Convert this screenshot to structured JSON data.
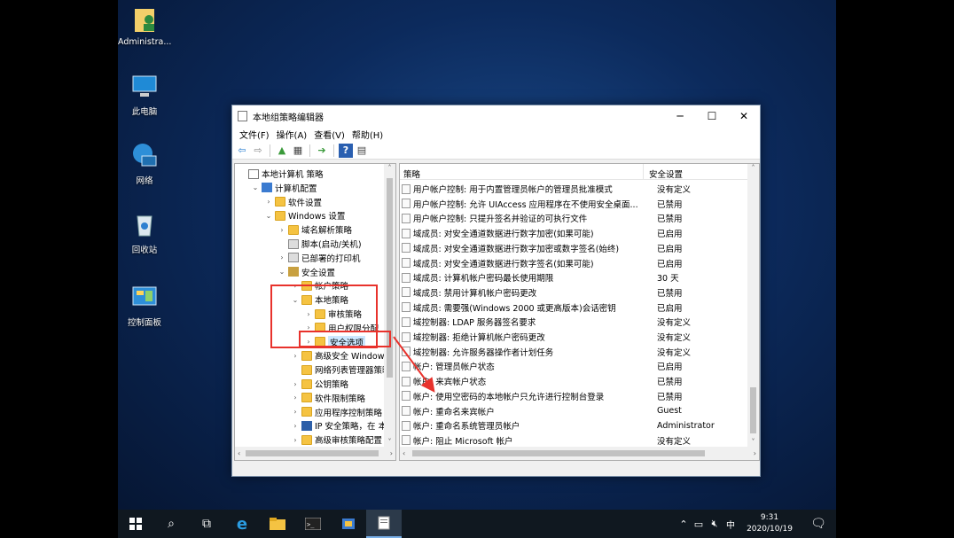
{
  "desktop_icons": [
    {
      "label": "Administra..."
    },
    {
      "label": "此电脑"
    },
    {
      "label": "网络"
    },
    {
      "label": "回收站"
    },
    {
      "label": "控制面板"
    }
  ],
  "window": {
    "title": "本地组策略编辑器"
  },
  "menu": [
    "文件(F)",
    "操作(A)",
    "查看(V)",
    "帮助(H)"
  ],
  "tree": [
    {
      "label": "本地计算机 策略",
      "level": 0,
      "exp": ""
    },
    {
      "label": "计算机配置",
      "level": 1,
      "exp": "⌄"
    },
    {
      "label": "软件设置",
      "level": 2,
      "exp": "›"
    },
    {
      "label": "Windows 设置",
      "level": 2,
      "exp": "⌄"
    },
    {
      "label": "域名解析策略",
      "level": 3,
      "exp": "›"
    },
    {
      "label": "脚本(启动/关机)",
      "level": 3,
      "exp": ""
    },
    {
      "label": "已部署的打印机",
      "level": 3,
      "exp": "›"
    },
    {
      "label": "安全设置",
      "level": 3,
      "exp": "⌄"
    },
    {
      "label": "帐户策略",
      "level": 4,
      "exp": "›"
    },
    {
      "label": "本地策略",
      "level": 4,
      "exp": "⌄"
    },
    {
      "label": "审核策略",
      "level": 5,
      "exp": "›"
    },
    {
      "label": "用户权限分配",
      "level": 5,
      "exp": "›"
    },
    {
      "label": "安全选项",
      "level": 5,
      "exp": "›"
    },
    {
      "label": "高级安全 Windows Defender",
      "level": 4,
      "exp": "›"
    },
    {
      "label": "网络列表管理器策略",
      "level": 4,
      "exp": ""
    },
    {
      "label": "公钥策略",
      "level": 4,
      "exp": "›"
    },
    {
      "label": "软件限制策略",
      "level": 4,
      "exp": "›"
    },
    {
      "label": "应用程序控制策略",
      "level": 4,
      "exp": "›"
    },
    {
      "label": "IP 安全策略，在 本地计算机",
      "level": 4,
      "exp": "›"
    },
    {
      "label": "高级审核策略配置",
      "level": 4,
      "exp": "›"
    }
  ],
  "list_header": {
    "policy": "策略",
    "setting": "安全设置"
  },
  "list": [
    {
      "policy": "用户帐户控制: 用于内置管理员帐户的管理员批准模式",
      "setting": "没有定义"
    },
    {
      "policy": "用户帐户控制: 允许 UIAccess 应用程序在不使用安全桌面...",
      "setting": "已禁用"
    },
    {
      "policy": "用户帐户控制: 只提升签名并验证的可执行文件",
      "setting": "已禁用"
    },
    {
      "policy": "域成员: 对安全通道数据进行数字加密(如果可能)",
      "setting": "已启用"
    },
    {
      "policy": "域成员: 对安全通道数据进行数字加密或数字签名(始终)",
      "setting": "已启用"
    },
    {
      "policy": "域成员: 对安全通道数据进行数字签名(如果可能)",
      "setting": "已启用"
    },
    {
      "policy": "域成员: 计算机帐户密码最长使用期限",
      "setting": "30 天"
    },
    {
      "policy": "域成员: 禁用计算机帐户密码更改",
      "setting": "已禁用"
    },
    {
      "policy": "域成员: 需要强(Windows 2000 或更高版本)会话密钥",
      "setting": "已启用"
    },
    {
      "policy": "域控制器: LDAP 服务器签名要求",
      "setting": "没有定义"
    },
    {
      "policy": "域控制器: 拒绝计算机帐户密码更改",
      "setting": "没有定义"
    },
    {
      "policy": "域控制器: 允许服务器操作者计划任务",
      "setting": "没有定义"
    },
    {
      "policy": "帐户: 管理员帐户状态",
      "setting": "已启用"
    },
    {
      "policy": "帐户: 来宾帐户状态",
      "setting": "已禁用"
    },
    {
      "policy": "帐户: 使用空密码的本地帐户只允许进行控制台登录",
      "setting": "已禁用"
    },
    {
      "policy": "帐户: 重命名来宾帐户",
      "setting": "Guest"
    },
    {
      "policy": "帐户: 重命名系统管理员帐户",
      "setting": "Administrator"
    },
    {
      "policy": "帐户: 阻止 Microsoft 帐户",
      "setting": "没有定义"
    }
  ],
  "taskbar": {
    "time": "9:31",
    "date": "2020/10/19",
    "ime": "中"
  },
  "colors": {
    "highlight": "#e8322c",
    "desktop": "#0c2a5c",
    "taskbar": "#101820"
  }
}
